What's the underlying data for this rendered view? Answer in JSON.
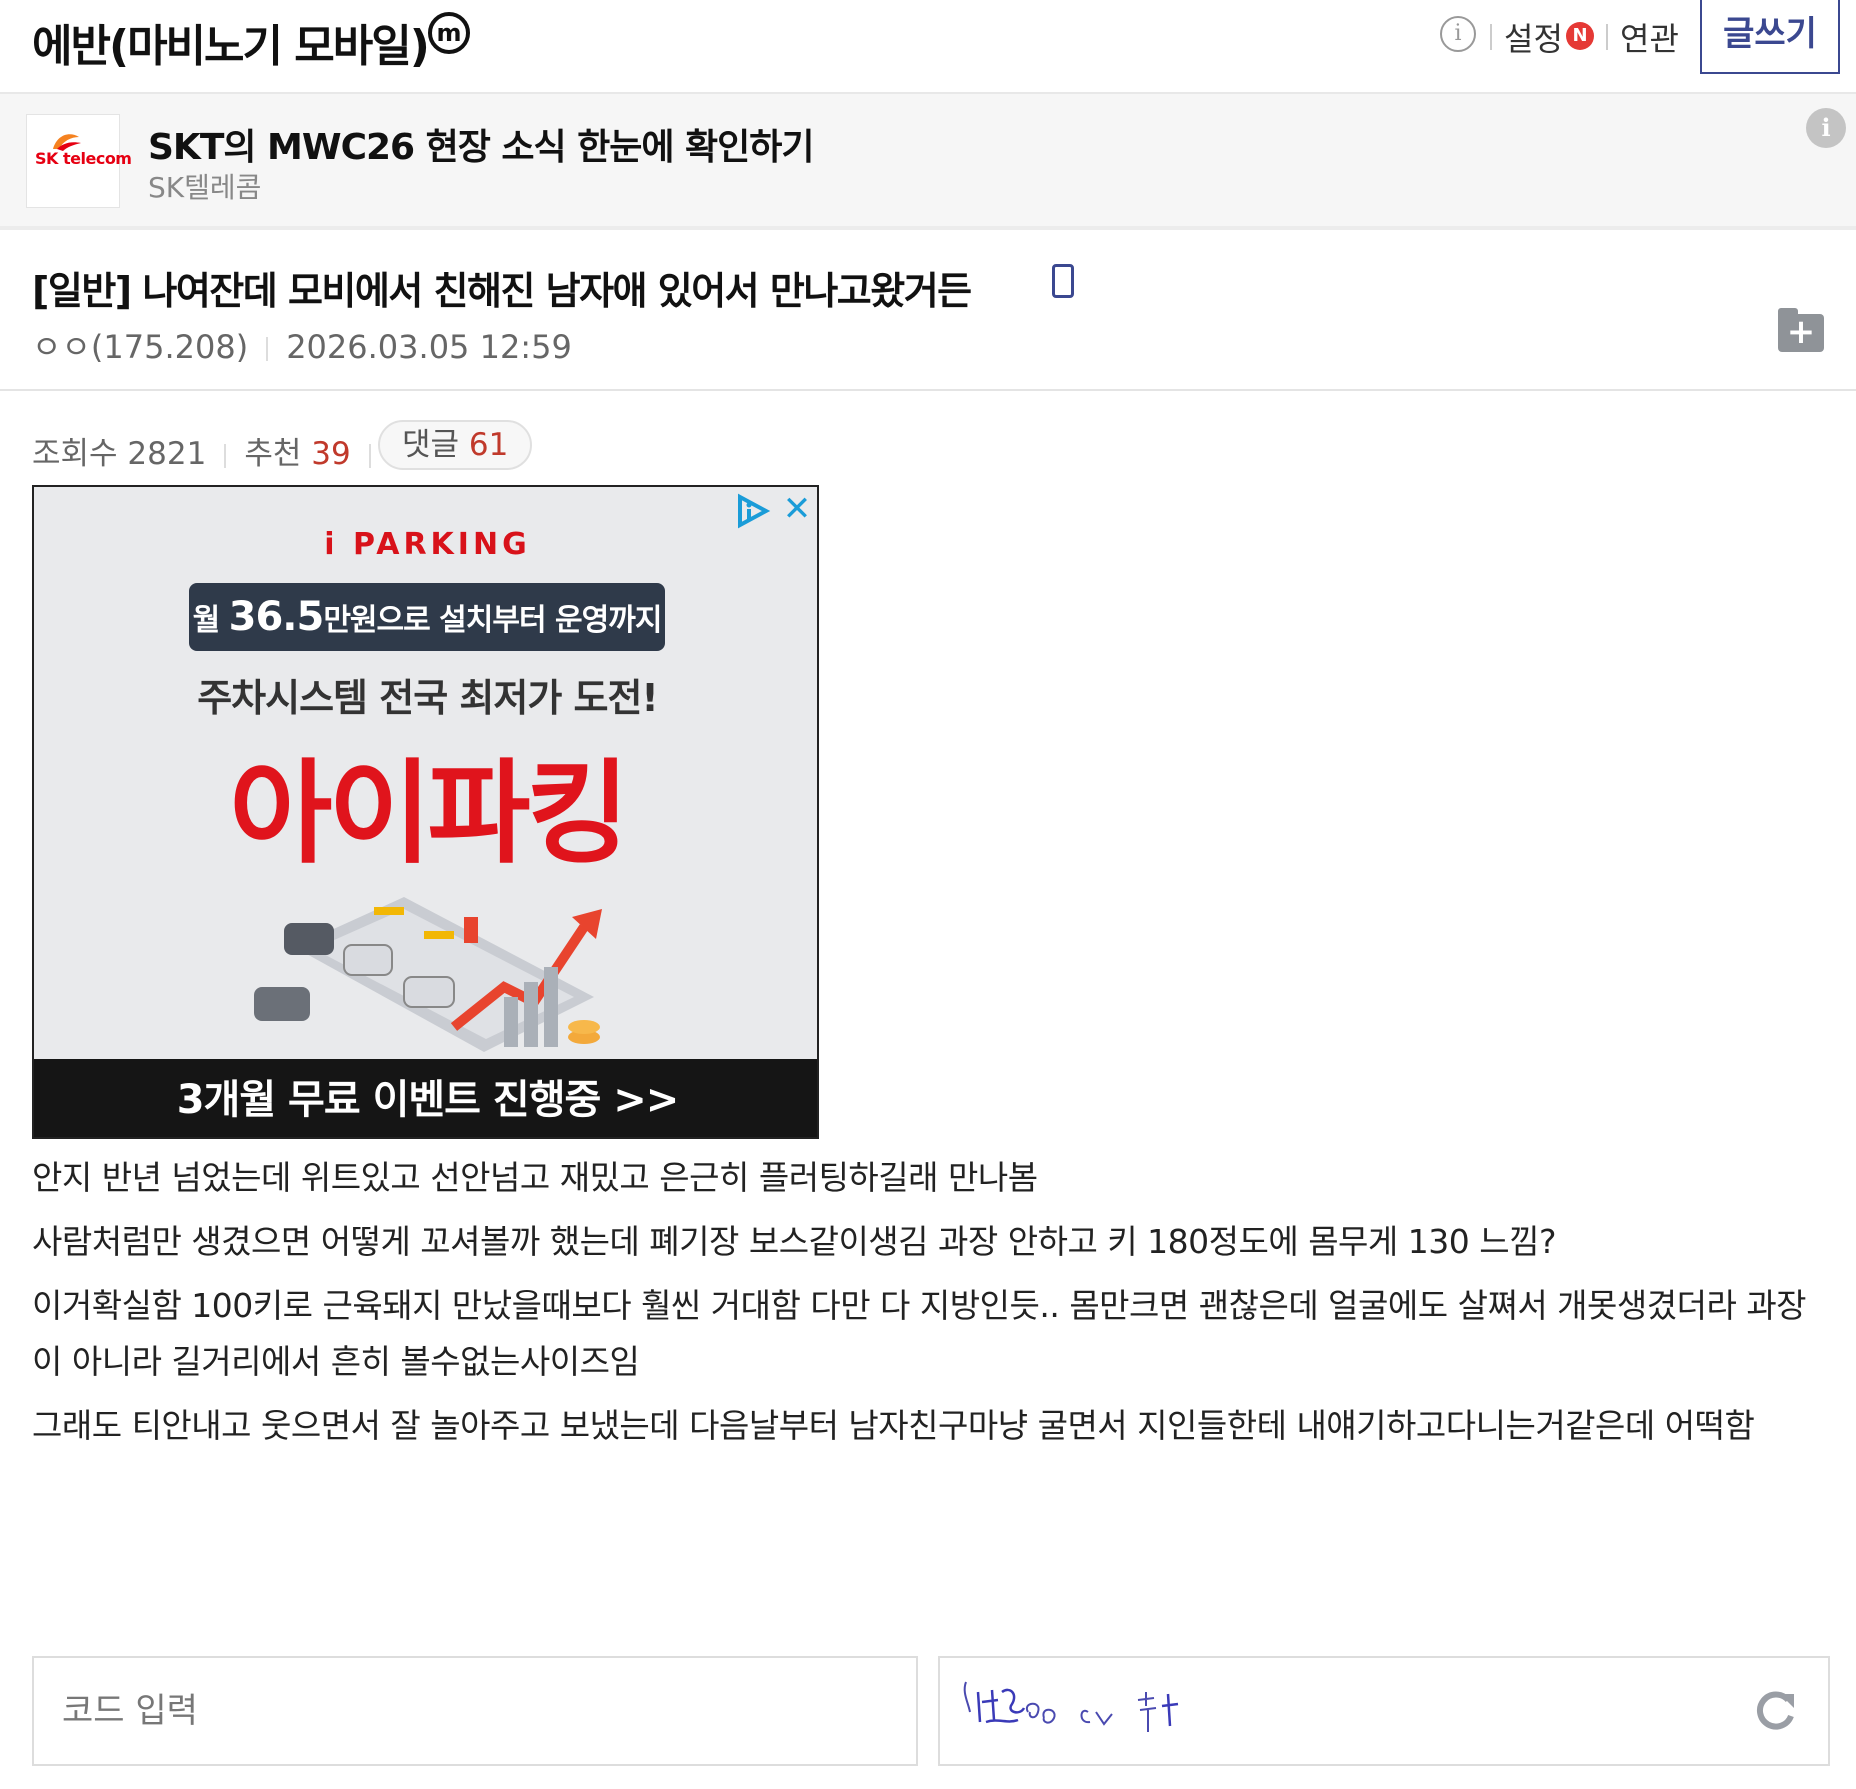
{
  "header": {
    "gallery_title": "에반(마비노기 모바일)",
    "badge": "m",
    "info_glyph": "i",
    "settings": "설정",
    "new_badge": "N",
    "related": "연관",
    "write": "글쓰기"
  },
  "banner": {
    "logo_text": "SK telecom",
    "title": "SKT의 MWC26 현장 소식 한눈에 확인하기",
    "subtitle": "SK텔레콤",
    "info_glyph": "i"
  },
  "post": {
    "title": "[일반] 나여잔데 모비에서 친해진 남자애 있어서 만나고왔거든",
    "author": "ㅇㅇ(175.208)",
    "date": "2026.03.05 12:59",
    "views_label": "조회수",
    "views": "2821",
    "recommend_label": "추천",
    "recommend": "39",
    "comments_label": "댓글",
    "comments": "61"
  },
  "ad": {
    "brand": "i PARKING",
    "pill_prefix": "월",
    "pill_amount": "36.5",
    "pill_suffix": "만원으로 설치부터 운영까지",
    "slogan": "주차시스템 전국 최저가 도전!",
    "headline": "아이파킹",
    "cta": "3개월 무료 이벤트 진행중 >>",
    "close": "✕"
  },
  "body": {
    "paragraphs": [
      "안지 반년 넘었는데 위트있고 선안넘고 재밌고 은근히 플러팅하길래 만나봄",
      "사람처럼만 생겼으면 어떻게 꼬셔볼까 했는데 폐기장 보스같이생김 과장 안하고 키 180정도에 몸무게 130 느낌?",
      "이거확실함 100키로 근육돼지 만났을때보다 훨씬 거대함 다만 다 지방인듯.. 몸만크면 괜찮은데 얼굴에도 살쪄서 개못생겼더라 과장이 아니라 길거리에서 흔히 볼수없는사이즈임",
      "그래도 티안내고 웃으면서 잘 놀아주고 보냈는데 다음날부터 남자친구마냥 굴면서 지인들한테 내얘기하고다니는거같은데 어떡함"
    ]
  },
  "captcha": {
    "placeholder": "코드 입력"
  },
  "icons": {
    "info": "info-icon",
    "mobile": "mobile-icon",
    "folder_add": "folder-add-icon",
    "adchoices": "adchoices-icon",
    "refresh": "refresh-icon"
  },
  "colors": {
    "accent": "#3b4890",
    "new_badge": "#e53935",
    "count_red": "#c0392b",
    "ad_red": "#e0141c"
  }
}
